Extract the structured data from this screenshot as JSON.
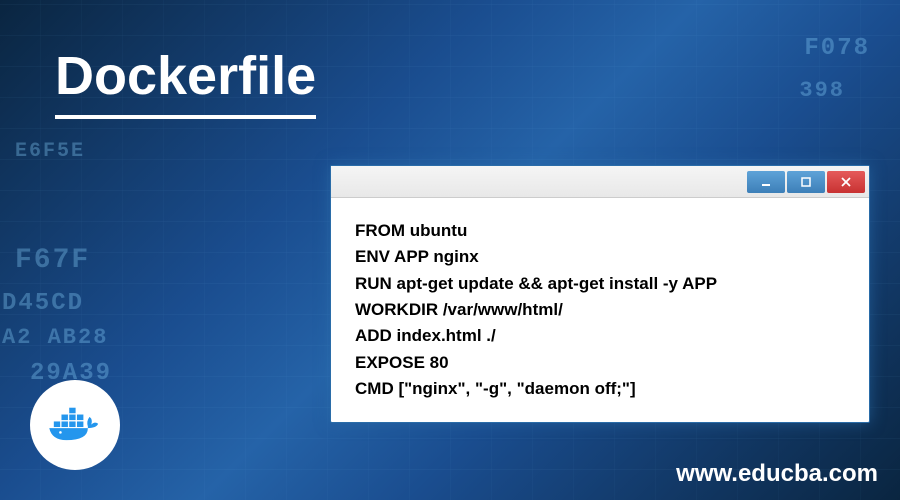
{
  "title": "Dockerfile",
  "hex_decorations": {
    "h1": "E6F5E",
    "h2": "F67F",
    "h3": "D45CD",
    "h4": "A2 AB28",
    "h5": "29A39",
    "h6": "F078",
    "h7": "398"
  },
  "code_window": {
    "lines": [
      "FROM ubuntu",
      "ENV APP nginx",
      "RUN apt-get update && apt-get install -y APP",
      "WORKDIR /var/www/html/",
      "ADD index.html ./",
      "EXPOSE 80",
      "CMD [\"nginx\", \"-g\", \"daemon off;\"]"
    ]
  },
  "website": "www.educba.com",
  "logo_alt": "Docker"
}
